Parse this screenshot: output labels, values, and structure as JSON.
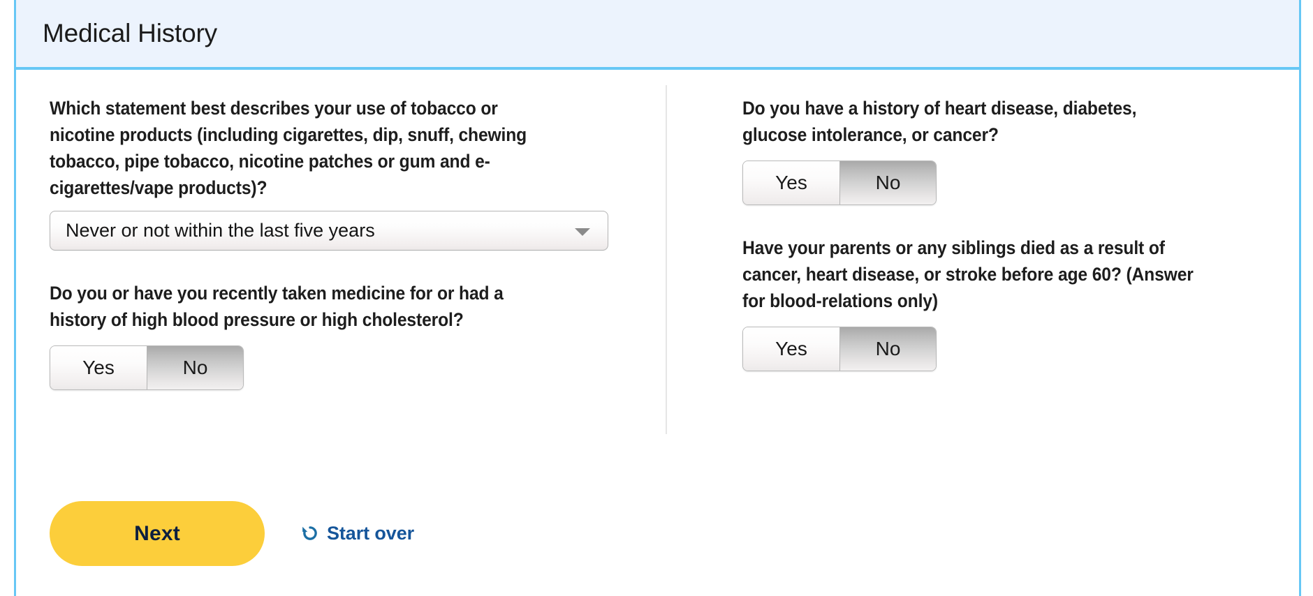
{
  "header": {
    "title": "Medical History",
    "accent_color": "#67c7f5",
    "background_color": "#ecf3fd"
  },
  "form": {
    "left_column": {
      "tobacco": {
        "question": "Which statement best describes your use of tobacco or nicotine products (including cigarettes, dip, snuff, chewing tobacco, pipe tobacco, nicotine patches or gum and e-cigarettes/vape products)?",
        "control": "dropdown",
        "selected": "Never or not within the last five years",
        "options": [
          "Never or not within the last five years"
        ],
        "arrow_icon": "chevron-down-icon"
      },
      "blood_pressure_cholesterol": {
        "question": "Do you or have you recently taken medicine for or had a history of high blood pressure or high cholesterol?",
        "control": "yes-no-toggle",
        "yes_label": "Yes",
        "no_label": "No",
        "selected": "No"
      }
    },
    "right_column": {
      "heart_disease": {
        "question": "Do you have a history of heart disease, diabetes, glucose intolerance, or cancer?",
        "control": "yes-no-toggle",
        "yes_label": "Yes",
        "no_label": "No",
        "selected": "No"
      },
      "family_history": {
        "question": "Have your parents or any siblings died as a result of cancer, heart disease, or stroke before age 60? (Answer for blood-relations only)",
        "control": "yes-no-toggle",
        "yes_label": "Yes",
        "no_label": "No",
        "selected": "No"
      }
    }
  },
  "actions": {
    "next_label": "Next",
    "next_color": "#fcce3b",
    "next_text_color": "#0c1f3f",
    "start_over_label": "Start over",
    "start_over_color": "#15559a",
    "start_over_icon": "restore-counterclockwise-arrow-icon"
  }
}
